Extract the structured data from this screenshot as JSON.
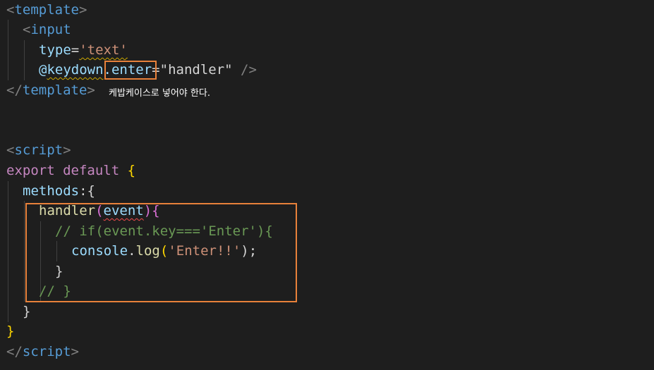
{
  "colors": {
    "background": "#1e1e1e",
    "tag_bracket": "#808080",
    "tag_name": "#569cd6",
    "attribute": "#9cdcfe",
    "string": "#ce9178",
    "keyword": "#c586c0",
    "function": "#dcdcaa",
    "comment": "#6a9955",
    "plain": "#d4d4d4",
    "annotation_box": "#e8813a"
  },
  "code": {
    "line1": {
      "open": "<",
      "tag": "template",
      "close": ">"
    },
    "line2": {
      "open": "<",
      "tag": "input"
    },
    "line3": {
      "attr": "type",
      "eq": "=",
      "value": "'text'"
    },
    "line4": {
      "at": "@",
      "attr": "keydown",
      "modifier": ".enter",
      "eq": "=",
      "value": "\"handler\"",
      "self_close": " />"
    },
    "line5": {
      "open": "</",
      "tag": "template",
      "close": ">"
    },
    "line8": {
      "open": "<",
      "tag": "script",
      "close": ">"
    },
    "line9": {
      "kw1": "export",
      "kw2": "default",
      "brace": " {"
    },
    "line10": {
      "prop": "methods",
      "rest": ":{"
    },
    "line11": {
      "fn": "handler",
      "paren_open": "(",
      "param": "event",
      "paren_close": "){"
    },
    "line12": {
      "comment": "// if(event.key==='Enter'){"
    },
    "line13": {
      "obj": "console",
      "dot": ".",
      "fn": "log",
      "paren_open": "(",
      "str": "'Enter!!'",
      "end": ");"
    },
    "line14": {
      "brace": "}"
    },
    "line15": {
      "comment": "// }"
    },
    "line16": {
      "brace": "}"
    },
    "line17": {
      "brace": "}"
    },
    "line18": {
      "open": "</",
      "tag": "script",
      "close": ">"
    }
  },
  "annotation": {
    "text": "케밥케이스로 넣어야 한다."
  }
}
